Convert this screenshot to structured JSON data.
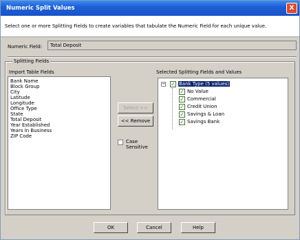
{
  "window": {
    "title": "Numeric Split Values",
    "close_glyph": "X"
  },
  "description": "Select one or more Splitting Fields to create variables that tabulate the Numeric Field for each unique value.",
  "numeric_field": {
    "label": "Numeric Field:",
    "value": "Total Deposit"
  },
  "splitting_fields": {
    "legend": "Splitting Fields"
  },
  "import_list": {
    "label": "Import Table Fields",
    "items": [
      "Bank Name",
      "Block Group",
      "City",
      "Latitude",
      "Longitude",
      "Office Type",
      "State",
      "Total Deposit",
      "Year Established",
      "Years In Business",
      "ZIP Code"
    ]
  },
  "buttons": {
    "select": "Select >>",
    "remove": "<< Remove",
    "ok": "OK",
    "cancel": "Cancel",
    "help": "Help"
  },
  "case_sensitive": {
    "line1": "Case",
    "line2": "Sensitive",
    "checked": false
  },
  "selected": {
    "label": "Selected Splitting Fields and Values",
    "root": {
      "label": "Bank Type (5 values)",
      "expander": "−",
      "checked": true
    },
    "values": [
      {
        "label": "No Value",
        "checked": true
      },
      {
        "label": "Commercial",
        "checked": true
      },
      {
        "label": "Credit Union",
        "checked": true
      },
      {
        "label": "Savings & Loan",
        "checked": true
      },
      {
        "label": "Savings Bank",
        "checked": true
      }
    ]
  },
  "check_glyph": "✓"
}
